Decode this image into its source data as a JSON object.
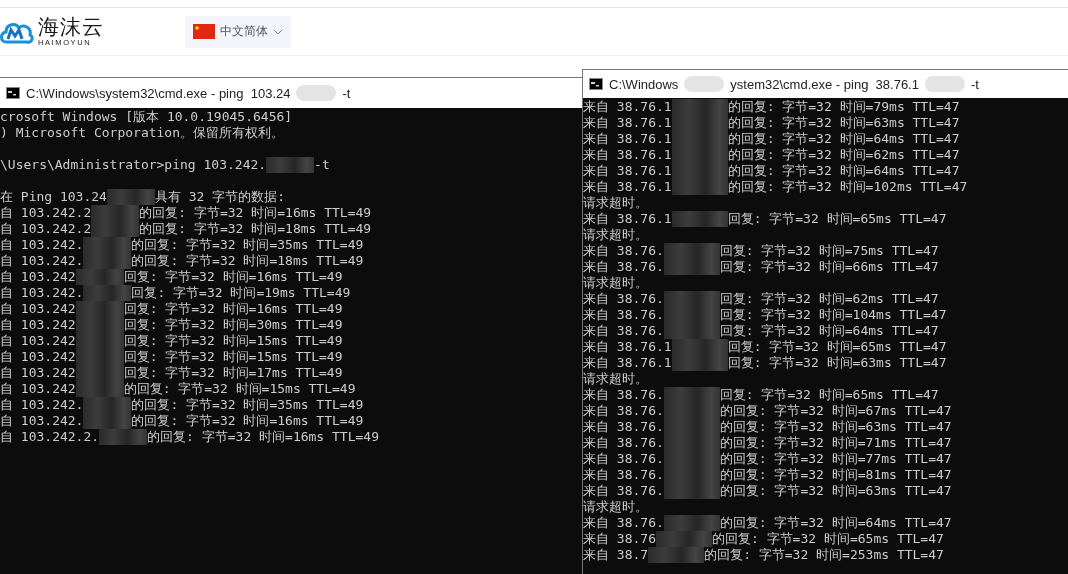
{
  "site": {
    "logo_text": "海沫云",
    "logo_sub": "HAIMOYUN",
    "language": "中文简体"
  },
  "windows": [
    {
      "title": [
        "C:\\Windows\\system32\\cmd.exe - ping  103.24",
        "-t"
      ],
      "lines": [
        {
          "kind": "text",
          "parts": [
            "crosoft Windows [版本 10.0.19045.6456]"
          ]
        },
        {
          "kind": "text",
          "parts": [
            ") Microsoft Corporation。保留所有权利。"
          ]
        },
        {
          "kind": "blank"
        },
        {
          "kind": "text",
          "parts": [
            "\\Users\\Administrator>ping 103.242.",
            "-t"
          ]
        },
        {
          "kind": "blank"
        },
        {
          "kind": "text",
          "parts": [
            "在 Ping 103.24",
            "具有 32 字节的数据:"
          ]
        },
        {
          "kind": "text",
          "parts": [
            "自 103.242.2",
            "的回复: 字节=32 时间=16ms TTL=49"
          ]
        },
        {
          "kind": "text",
          "parts": [
            "自 103.242.2",
            "的回复: 字节=32 时间=18ms TTL=49"
          ]
        },
        {
          "kind": "text",
          "parts": [
            "自 103.242.",
            "的回复: 字节=32 时间=35ms TTL=49"
          ]
        },
        {
          "kind": "text",
          "parts": [
            "自 103.242.",
            "的回复: 字节=32 时间=18ms TTL=49"
          ]
        },
        {
          "kind": "text",
          "parts": [
            "自 103.242",
            "回复: 字节=32 时间=16ms TTL=49"
          ]
        },
        {
          "kind": "text",
          "parts": [
            "自 103.242.",
            "回复: 字节=32 时间=19ms TTL=49"
          ]
        },
        {
          "kind": "text",
          "parts": [
            "自 103.242",
            "回复: 字节=32 时间=16ms TTL=49"
          ]
        },
        {
          "kind": "text",
          "parts": [
            "自 103.242",
            "回复: 字节=32 时间=30ms TTL=49"
          ]
        },
        {
          "kind": "text",
          "parts": [
            "自 103.242",
            "回复: 字节=32 时间=15ms TTL=49"
          ]
        },
        {
          "kind": "text",
          "parts": [
            "自 103.242",
            "回复: 字节=32 时间=15ms TTL=49"
          ]
        },
        {
          "kind": "text",
          "parts": [
            "自 103.242",
            "回复: 字节=32 时间=17ms TTL=49"
          ]
        },
        {
          "kind": "text",
          "parts": [
            "自 103.242",
            "的回复: 字节=32 时间=15ms TTL=49"
          ]
        },
        {
          "kind": "text",
          "parts": [
            "自 103.242.",
            "的回复: 字节=32 时间=35ms TTL=49"
          ]
        },
        {
          "kind": "text",
          "parts": [
            "自 103.242.",
            "的回复: 字节=32 时间=16ms TTL=49"
          ]
        },
        {
          "kind": "text",
          "parts": [
            "自 103.242.2.",
            "的回复: 字节=32 时间=16ms TTL=49"
          ]
        }
      ]
    },
    {
      "title": [
        "C:\\Windows",
        "ystem32\\cmd.exe - ping  38.76.1",
        "-t"
      ],
      "lines": [
        {
          "kind": "text",
          "parts": [
            "来自 38.76.1",
            "的回复: 字节=32 时间=79ms TTL=47"
          ]
        },
        {
          "kind": "text",
          "parts": [
            "来自 38.76.1",
            "的回复: 字节=32 时间=63ms TTL=47"
          ]
        },
        {
          "kind": "text",
          "parts": [
            "来自 38.76.1",
            "的回复: 字节=32 时间=64ms TTL=47"
          ]
        },
        {
          "kind": "text",
          "parts": [
            "来自 38.76.1",
            "的回复: 字节=32 时间=62ms TTL=47"
          ]
        },
        {
          "kind": "text",
          "parts": [
            "来自 38.76.1",
            "的回复: 字节=32 时间=64ms TTL=47"
          ]
        },
        {
          "kind": "text",
          "parts": [
            "来自 38.76.1",
            "的回复: 字节=32 时间=102ms TTL=47"
          ]
        },
        {
          "kind": "text",
          "parts": [
            "请求超时。"
          ]
        },
        {
          "kind": "text",
          "parts": [
            "来自 38.76.1",
            "回复: 字节=32 时间=65ms TTL=47"
          ]
        },
        {
          "kind": "text",
          "parts": [
            "请求超时。"
          ]
        },
        {
          "kind": "text",
          "parts": [
            "来自 38.76.",
            "回复: 字节=32 时间=75ms TTL=47"
          ]
        },
        {
          "kind": "text",
          "parts": [
            "来自 38.76.",
            "回复: 字节=32 时间=66ms TTL=47"
          ]
        },
        {
          "kind": "text",
          "parts": [
            "请求超时。"
          ]
        },
        {
          "kind": "text",
          "parts": [
            "来自 38.76.",
            "回复: 字节=32 时间=62ms TTL=47"
          ]
        },
        {
          "kind": "text",
          "parts": [
            "来自 38.76.",
            "回复: 字节=32 时间=104ms TTL=47"
          ]
        },
        {
          "kind": "text",
          "parts": [
            "来自 38.76.",
            "回复: 字节=32 时间=64ms TTL=47"
          ]
        },
        {
          "kind": "text",
          "parts": [
            "来自 38.76.1",
            "回复: 字节=32 时间=65ms TTL=47"
          ]
        },
        {
          "kind": "text",
          "parts": [
            "来自 38.76.1",
            "回复: 字节=32 时间=63ms TTL=47"
          ]
        },
        {
          "kind": "text",
          "parts": [
            "请求超时。"
          ]
        },
        {
          "kind": "text",
          "parts": [
            "来自 38.76.",
            "回复: 字节=32 时间=65ms TTL=47"
          ]
        },
        {
          "kind": "text",
          "parts": [
            "来自 38.76.",
            "的回复: 字节=32 时间=67ms TTL=47"
          ]
        },
        {
          "kind": "text",
          "parts": [
            "来自 38.76.",
            "的回复: 字节=32 时间=63ms TTL=47"
          ]
        },
        {
          "kind": "text",
          "parts": [
            "来自 38.76.",
            "的回复: 字节=32 时间=71ms TTL=47"
          ]
        },
        {
          "kind": "text",
          "parts": [
            "来自 38.76.",
            "的回复: 字节=32 时间=77ms TTL=47"
          ]
        },
        {
          "kind": "text",
          "parts": [
            "来自 38.76.",
            "的回复: 字节=32 时间=81ms TTL=47"
          ]
        },
        {
          "kind": "text",
          "parts": [
            "来自 38.76.",
            "的回复: 字节=32 时间=63ms TTL=47"
          ]
        },
        {
          "kind": "text",
          "parts": [
            "请求超时。"
          ]
        },
        {
          "kind": "text",
          "parts": [
            "来自 38.76.",
            "的回复: 字节=32 时间=64ms TTL=47"
          ]
        },
        {
          "kind": "text",
          "parts": [
            "来自 38.76",
            "的回复: 字节=32 时间=65ms TTL=47"
          ]
        },
        {
          "kind": "text",
          "parts": [
            "来自 38.7",
            "的回复: 字节=32 时间=253ms TTL=47"
          ]
        }
      ]
    }
  ]
}
